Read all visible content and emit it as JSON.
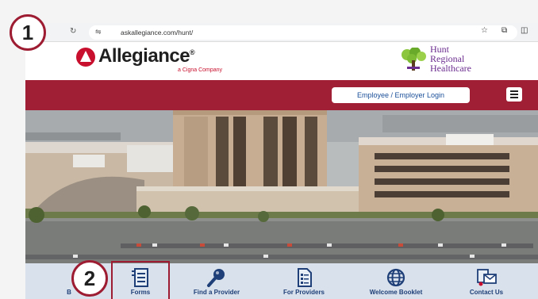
{
  "browser": {
    "url": "askallegiance.com/hunt/",
    "back_icon": "back-arrow-icon",
    "reload_icon": "reload-icon"
  },
  "header": {
    "brand_name": "Allegiance",
    "brand_reg": "®",
    "brand_tagline": "a Cigna Company",
    "partner_line1": "Hunt",
    "partner_line2": "Regional",
    "partner_line3": "Healthcare"
  },
  "redbar": {
    "login_label": "Employee / Employer Login"
  },
  "nav": {
    "items": [
      {
        "label": "B",
        "icon": "benefits-icon"
      },
      {
        "label": "Forms",
        "icon": "forms-icon"
      },
      {
        "label": "Find a Provider",
        "icon": "magnifier-icon"
      },
      {
        "label": "For Providers",
        "icon": "document-icon"
      },
      {
        "label": "Welcome Booklet",
        "icon": "globe-icon"
      },
      {
        "label": "Contact Us",
        "icon": "mail-icon"
      }
    ]
  },
  "callouts": {
    "one": "1",
    "two": "2"
  },
  "colors": {
    "brand_red": "#a01f35",
    "callout_red": "#9e1c32",
    "nav_bg": "#d9e2ec",
    "nav_text": "#1f3f78",
    "partner_purple": "#6b2d8f"
  }
}
